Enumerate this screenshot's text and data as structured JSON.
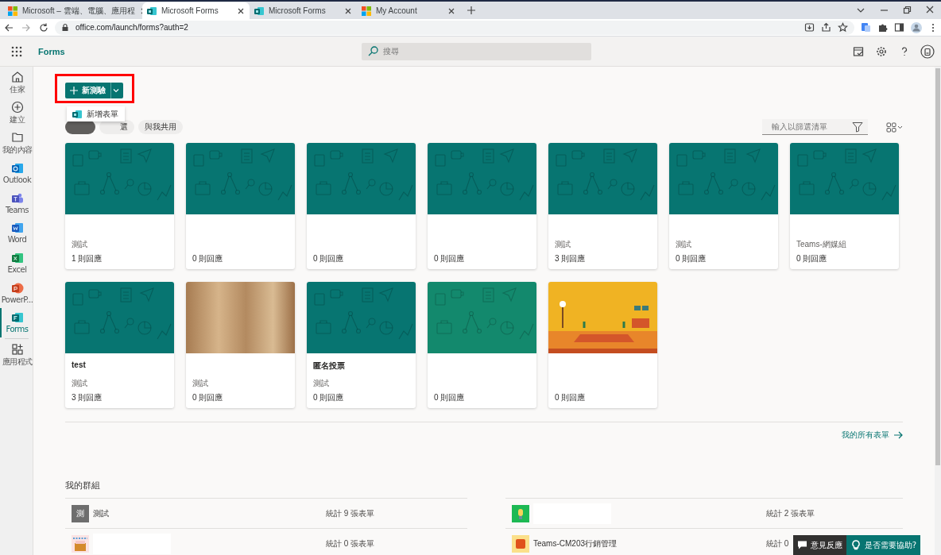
{
  "browser": {
    "tabs": [
      {
        "title": "Microsoft – 雲端、電腦、應用程",
        "selected": false
      },
      {
        "title": "Microsoft Forms",
        "selected": true
      },
      {
        "title": "Microsoft Forms",
        "selected": false
      },
      {
        "title": "My Account",
        "selected": false
      }
    ],
    "address": "office.com/launch/forms?auth=2"
  },
  "app": {
    "name": "Forms",
    "search": {
      "placeholder": "搜尋"
    }
  },
  "rail": [
    {
      "label": "住家",
      "selected": false
    },
    {
      "label": "建立",
      "selected": false
    },
    {
      "label": "我的內容",
      "selected": false
    },
    {
      "label": "Outlook",
      "selected": false
    },
    {
      "label": "Teams",
      "selected": false
    },
    {
      "label": "Word",
      "selected": false
    },
    {
      "label": "Excel",
      "selected": false
    },
    {
      "label": "PowerP...",
      "selected": false
    },
    {
      "label": "Forms",
      "selected": true
    },
    {
      "label": "應用程式",
      "selected": false
    }
  ],
  "new_button": {
    "label": "新測驗"
  },
  "new_menu": [
    {
      "label": "新增表單"
    }
  ],
  "filters": [
    {
      "selected": true
    },
    {
      "label": "選",
      "selected": false
    },
    {
      "label": "與我共用",
      "selected": false
    }
  ],
  "filter_field": {
    "placeholder": "輸入以篩選清單"
  },
  "forms": [
    {
      "kind": "pattern",
      "color": "#077571",
      "group": "測試",
      "responses": "1 則回應"
    },
    {
      "kind": "pattern",
      "color": "#077571",
      "responses": "0 則回應"
    },
    {
      "kind": "pattern",
      "color": "#077571",
      "responses": "0 則回應"
    },
    {
      "kind": "pattern",
      "color": "#077571",
      "responses": "0 則回應"
    },
    {
      "kind": "pattern",
      "color": "#077571",
      "group": "測試",
      "responses": "3 則回應"
    },
    {
      "kind": "pattern",
      "color": "#077571",
      "group": "測試",
      "responses": "0 則回應"
    },
    {
      "kind": "pattern",
      "color": "#077571",
      "group": "Teams-網媒組",
      "responses": "0 則回應"
    },
    {
      "kind": "pattern",
      "color": "#077571",
      "title": "test",
      "group": "測試",
      "responses": "3 則回應"
    },
    {
      "kind": "photo",
      "group": "測試",
      "responses": "0 則回應"
    },
    {
      "kind": "pattern",
      "color": "#077571",
      "title": "匿名投票",
      "group": "測試",
      "responses": "0 則回應"
    },
    {
      "kind": "pattern",
      "color": "#13896d",
      "responses": "0 則回應"
    },
    {
      "kind": "illustration",
      "responses": "0 則回應"
    }
  ],
  "all_forms_link": "我的所有表單",
  "groups": {
    "title": "我的群組",
    "rows": [
      {
        "kind": "letter",
        "avatar_text": "測",
        "name": "測試",
        "name_hidden": false,
        "count": "統計 9 張表單"
      },
      {
        "kind": "bulb",
        "name_hidden": true,
        "count": "統計 2 張表單"
      },
      {
        "kind": "cake",
        "name_hidden": true,
        "count": "統計 0 張表單"
      },
      {
        "kind": "block",
        "name": "Teams-CM203行銷管理",
        "name_hidden": false,
        "count": "統計 0"
      }
    ]
  },
  "feedback_button": "意見反應",
  "help_button": "是否需要協助?"
}
